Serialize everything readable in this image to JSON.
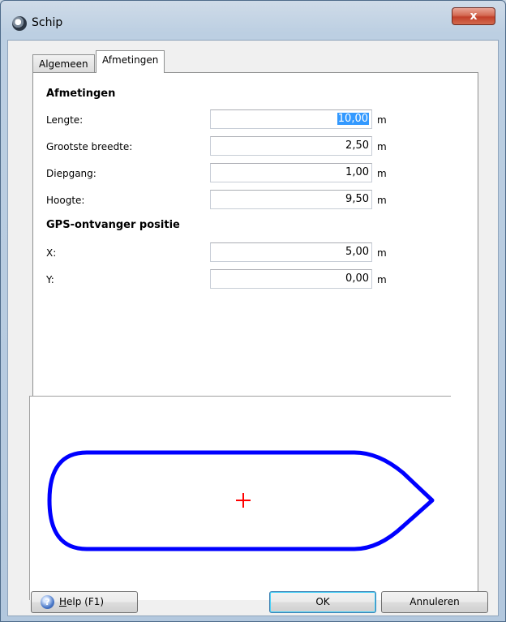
{
  "window": {
    "title": "Schip",
    "close_label": "x"
  },
  "tabs": [
    {
      "label": "Algemeen",
      "active": false
    },
    {
      "label": "Afmetingen",
      "active": true
    }
  ],
  "afmetingen": {
    "title": "Afmetingen",
    "rows": [
      {
        "label": "Lengte:",
        "value": "10,00",
        "unit": "m",
        "selected": true
      },
      {
        "label": "Grootste breedte:",
        "value": "2,50",
        "unit": "m"
      },
      {
        "label": "Diepgang:",
        "value": "1,00",
        "unit": "m"
      },
      {
        "label": "Hoogte:",
        "value": "9,50",
        "unit": "m"
      }
    ]
  },
  "gps": {
    "title": "GPS-ontvanger positie",
    "rows": [
      {
        "label": "X:",
        "value": "5,00",
        "unit": "m"
      },
      {
        "label": "Y:",
        "value": "0,00",
        "unit": "m"
      }
    ]
  },
  "preview": {
    "hull_color": "#0000ff",
    "marker_color": "#ff0000"
  },
  "buttons": {
    "help_prefix": "H",
    "help_rest": "elp (F1)",
    "ok": "OK",
    "cancel": "Annuleren"
  }
}
